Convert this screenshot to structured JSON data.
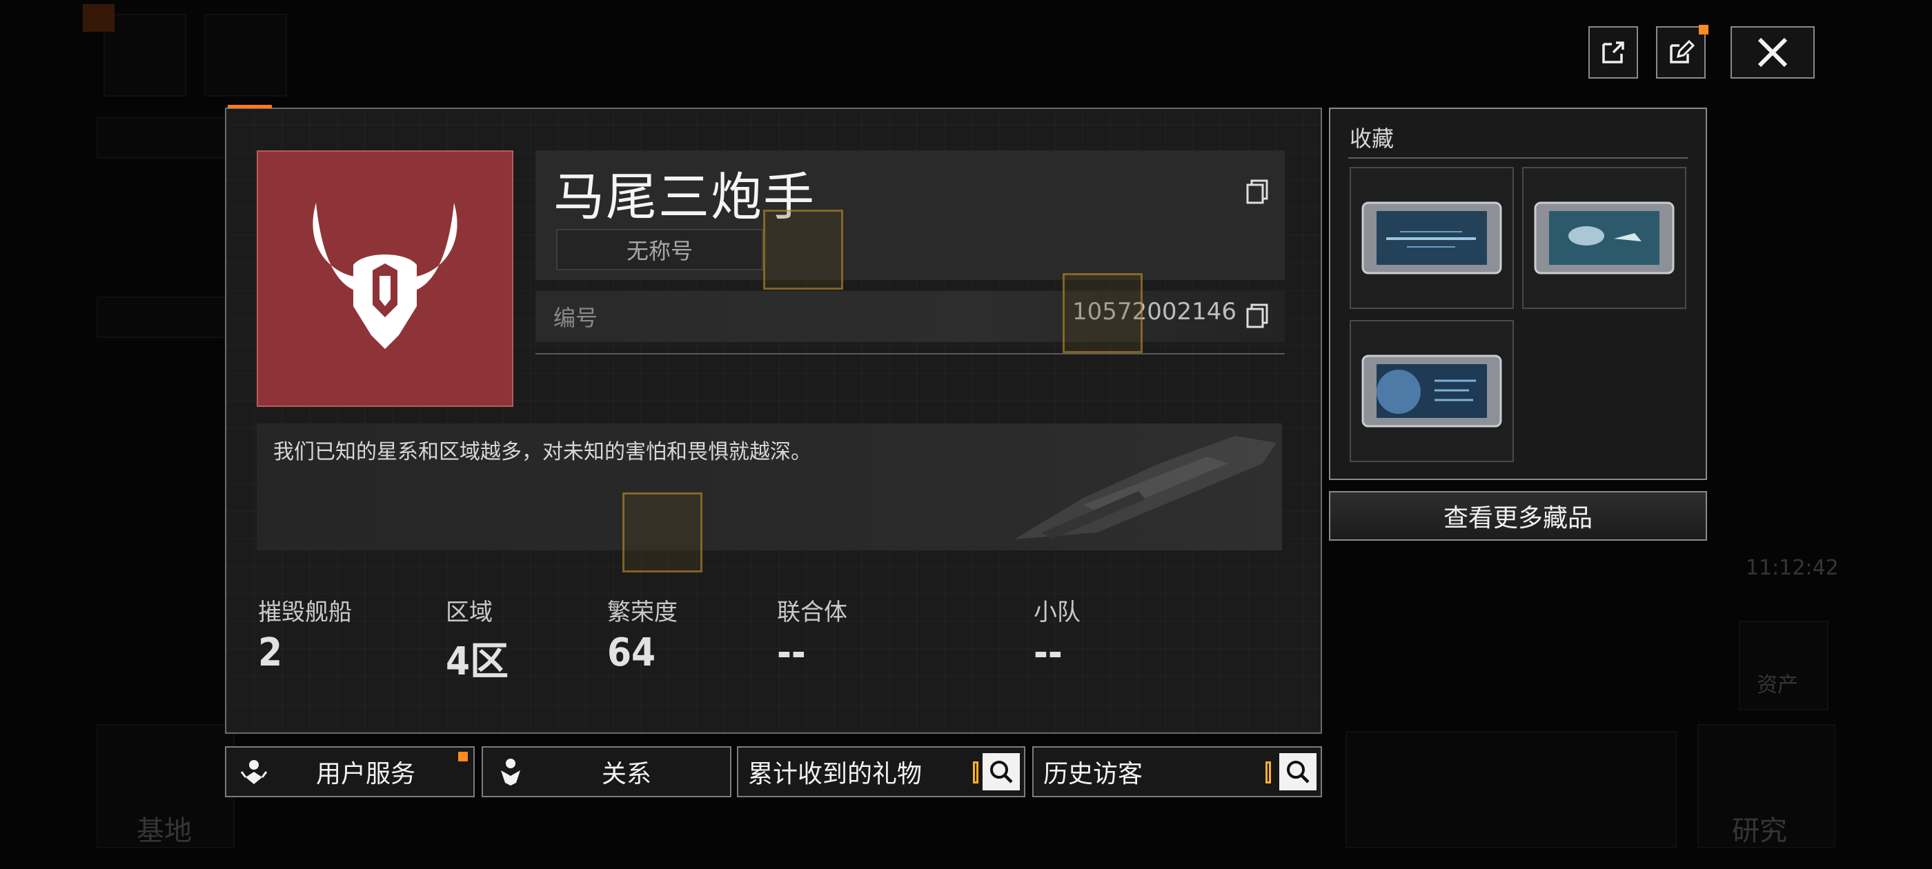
{
  "top_bar": {
    "share_label": "",
    "edit_label": "",
    "close_label": ""
  },
  "profile": {
    "player_name": "马尾三炮手",
    "title_chip": "无称号",
    "id_label": "编号",
    "id_value": "10572002146",
    "bio": "我们已知的星系和区域越多，对未知的害怕和畏惧就越深。"
  },
  "stats": [
    {
      "label": "摧毁舰船",
      "value": "2"
    },
    {
      "label": "区域",
      "value": "4区"
    },
    {
      "label": "繁荣度",
      "value": "64"
    },
    {
      "label": "联合体",
      "value": "--"
    },
    {
      "label": "小队",
      "value": "--"
    }
  ],
  "collection": {
    "title": "收藏",
    "more_button": "查看更多藏品",
    "items": [
      "collection-card-1",
      "collection-card-2",
      "collection-card-3"
    ]
  },
  "actions": {
    "user_service": "用户服务",
    "relations": "关系",
    "gifts_received": "累计收到的礼物",
    "visitors": "历史访客"
  },
  "background": {
    "base_label": "基地",
    "research_label": "研究",
    "asset_label": "资产",
    "time": "11:12:42"
  },
  "colors": {
    "accent": "#ff8a1e",
    "avatar_bg": "#8e3438",
    "panel_bg": "#1b1b1b"
  }
}
